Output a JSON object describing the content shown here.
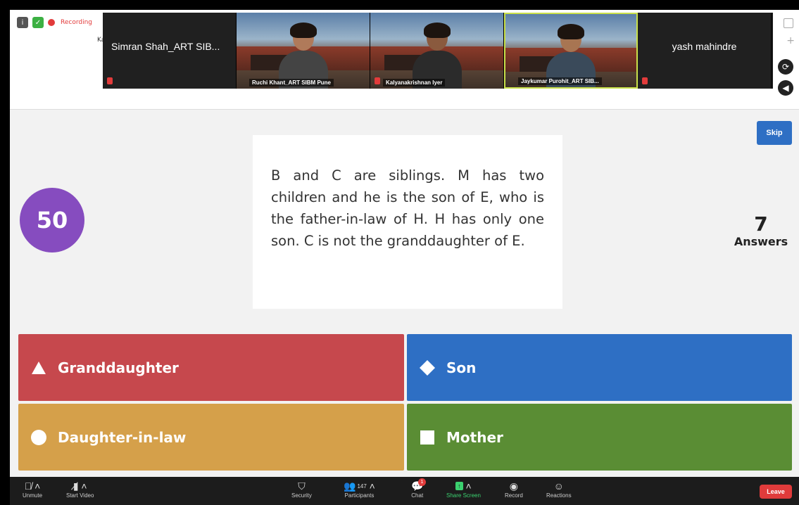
{
  "top_bar": {
    "recording_label": "Recording",
    "truncated_label": "Ka"
  },
  "gallery": {
    "tiles": [
      {
        "name": "Simran Shah_ART SIB...",
        "type": "name"
      },
      {
        "name": "Ruchi Khant_ART SIBM Pune",
        "type": "video"
      },
      {
        "name": "Kalyanakrishnan Iyer",
        "type": "video"
      },
      {
        "name": "Jaykumar Purohit_ART SIB...",
        "type": "video"
      },
      {
        "name": "yash mahindre",
        "type": "name"
      }
    ]
  },
  "quiz": {
    "skip_label": "Skip",
    "timer": "50",
    "question": "B and C are siblings. M has two children and he is the son of E, who is the father-in-law of H. H has only one son. C is not the granddaughter of E.",
    "answers_count": "7",
    "answers_label": "Answers",
    "options": [
      {
        "label": "Granddaughter",
        "shape": "triangle",
        "color": "#c6484d"
      },
      {
        "label": "Son",
        "shape": "diamond",
        "color": "#2e6fc4"
      },
      {
        "label": "Daughter-in-law",
        "shape": "circle",
        "color": "#d5a04a"
      },
      {
        "label": "Mother",
        "shape": "square",
        "color": "#5a8d34"
      }
    ]
  },
  "toolbar": {
    "unmute": "Unmute",
    "start_video": "Start Video",
    "security": "Security",
    "participants": "Participants",
    "participants_count": "147",
    "chat": "Chat",
    "chat_badge": "1",
    "share_screen": "Share Screen",
    "record": "Record",
    "reactions": "Reactions",
    "leave": "Leave"
  }
}
